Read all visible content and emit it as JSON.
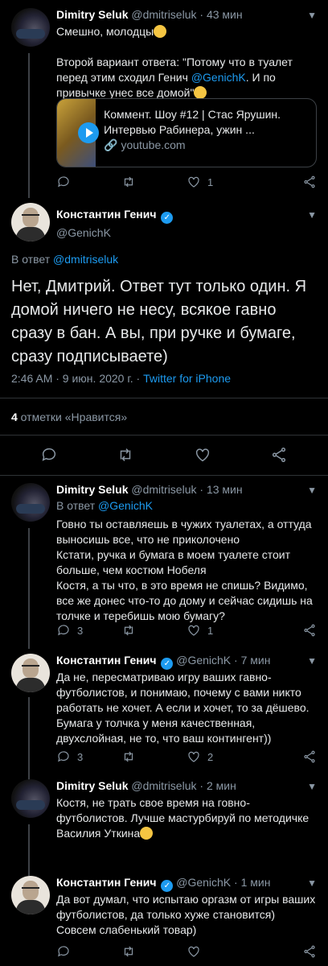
{
  "tweets": [
    {
      "name": "Dimitry Seluk",
      "handle": "@dmitriseluk",
      "time": "43 мин",
      "line1": "Смешно, молодцы",
      "line2a": "Второй вариант ответа: \"Потому что в туалет перед этим сходил Генич ",
      "mention": "@GenichK",
      "line2b": ". И по привычке унес все домой\"",
      "card_title": "Коммент. Шоу #12 | Стас Ярушин. Интервью Рабинера, ужин ...",
      "card_url": "youtube.com",
      "replies": "",
      "likes": "1"
    },
    {
      "name": "Константин Генич",
      "handle": "@GenichK",
      "reply_prefix": "В ответ ",
      "reply_to": "@dmitriseluk",
      "text": "Нет, Дмитрий. Ответ тут только один. Я домой ничего не несу, всякое гавно сразу в бан. А вы, при ручке и бумаге, сразу подписываете)",
      "datetime": "2:46 AM · 9 июн. 2020 г. · ",
      "source": "Twitter for iPhone",
      "likes_count": "4",
      "likes_label": " отметки «Нравится»"
    },
    {
      "name": "Dimitry Seluk",
      "handle": "@dmitriseluk",
      "time": "13 мин",
      "reply_prefix": "В ответ ",
      "reply_to": "@GenichK",
      "text": "Говно ты оставляешь в чужих туалетах, а оттуда выносишь все, что не приколочено\nКстати, ручка и бумага в моем туалете стоит больше, чем костюм Нобеля\nКостя, а ты что, в это время не спишь? Видимо, все же донес что-то до дому и сейчас сидишь на толчке и теребишь мою бумагу?",
      "replies": "3",
      "likes": "1"
    },
    {
      "name": "Константин Генич",
      "handle": "@GenichK",
      "time": "7 мин",
      "text": "Да не, пересматриваю игру ваших гавно-футболистов, и понимаю, почему с вами никто работать не хочет. А если и хочет, то за дёшево. Бумага у толчка у меня качественная, двухслойная, не то, что ваш контингент))",
      "replies": "3",
      "likes": "2"
    },
    {
      "name": "Dimitry Seluk",
      "handle": "@dmitriseluk",
      "time": "2 мин",
      "text": "Костя, не трать свое время на говно-футболистов. Лучше мастурбируй по методичке Василия Уткина"
    },
    {
      "name": "Константин Генич",
      "handle": "@GenichK",
      "time": "1 мин",
      "text": "Да вот думал, что испытаю оргазм от игры ваших футболистов, да только хуже становится) Совсем слабенький товар)"
    }
  ],
  "separator": " · ",
  "colors": {
    "accent": "#1d9bf0",
    "background": "#000000",
    "muted": "#8b98a5"
  }
}
